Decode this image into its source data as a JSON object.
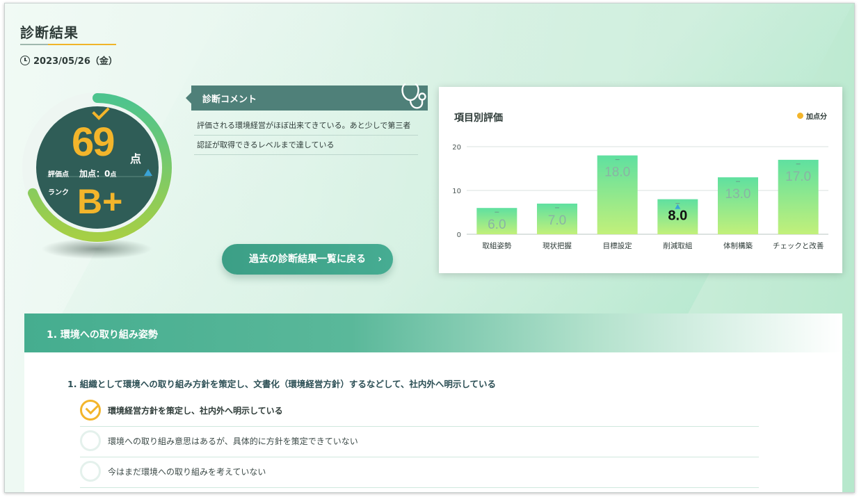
{
  "header": {
    "title": "診断結果",
    "date": "2023/05/26（金）"
  },
  "score": {
    "label": "評価点",
    "value": "69",
    "unit": "点",
    "bonus_label": "加点：0",
    "bonus_unit": "点",
    "rank_label": "ランク",
    "rank": "B+",
    "gauge_fraction": 0.69
  },
  "comment": {
    "heading": "診断コメント",
    "lines": [
      "評価される環境経営がほぼ出来てきている。あと少しで第三者",
      "認証が取得できるレベルまで達している"
    ]
  },
  "back_button": {
    "label": "過去の診断結果一覧に戻る",
    "chevron": "›"
  },
  "chart_data": {
    "type": "bar",
    "title": "項目別評価",
    "legend": [
      {
        "name": "加点分",
        "color": "#f3b52b"
      }
    ],
    "categories": [
      "取組姿勢",
      "現状把握",
      "目標設定",
      "削減取組",
      "体制構築",
      "チェックと改善"
    ],
    "values": [
      6.0,
      7.0,
      18.0,
      8.0,
      13.0,
      17.0
    ],
    "value_labels": [
      "6.0",
      "7.0",
      "18.0",
      "8.0",
      "13.0",
      "17.0"
    ],
    "highlight_index": 3,
    "yticks": [
      0,
      10,
      20
    ],
    "ylim": [
      0,
      20
    ],
    "grid": true,
    "legend_position": "top-right"
  },
  "section": {
    "heading": "1. 環境への取り組み姿勢",
    "question": "1. 組織として環境への取り組み方針を策定し、文書化（環境経営方針）するなどして、社内外へ明示している",
    "options": [
      {
        "label": "環境経営方針を策定し、社内外へ明示している",
        "selected": true
      },
      {
        "label": "環境への取り組み意思はあるが、具体的に方針を策定できていない",
        "selected": false
      },
      {
        "label": "今はまだ環境への取り組みを考えていない",
        "selected": false
      }
    ]
  },
  "colors": {
    "accent_green": "#45ad8f",
    "dark_green": "#2f5d57",
    "gold": "#f3b52b",
    "bar_gradient_top": "#5fe0a0",
    "bar_gradient_bottom": "#c2f07a"
  }
}
